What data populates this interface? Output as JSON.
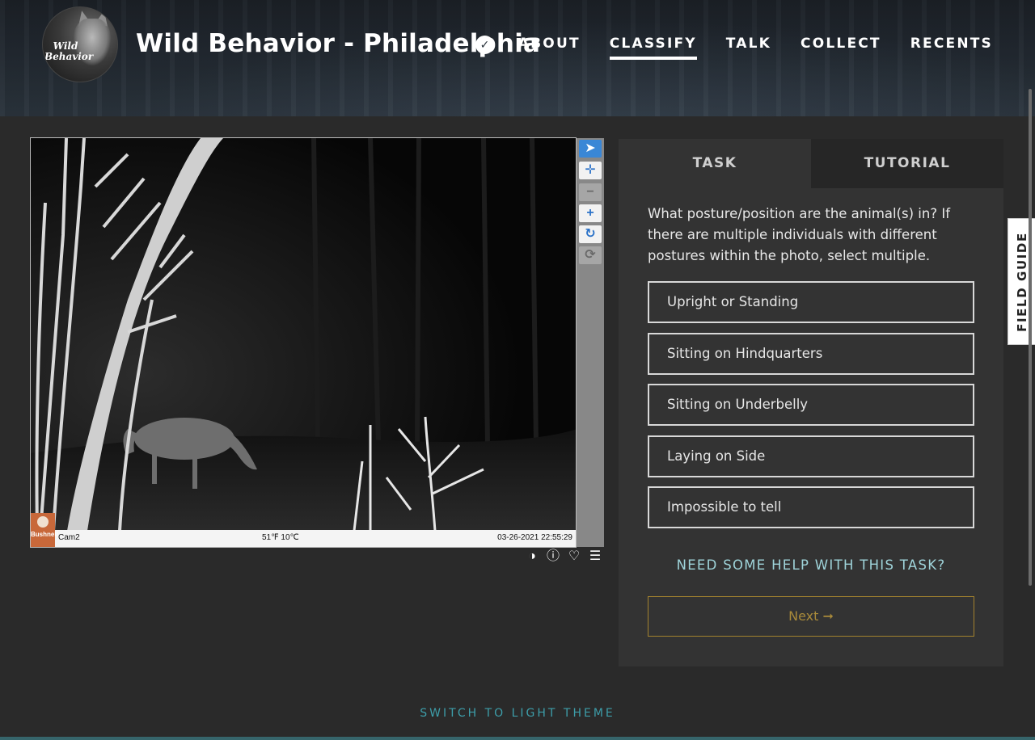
{
  "header": {
    "logo_text": "Wild Behavior",
    "project_title": "Wild Behavior - Philadelphia",
    "verified_icon": "check",
    "nav": [
      {
        "label": "ABOUT",
        "active": false
      },
      {
        "label": "CLASSIFY",
        "active": true
      },
      {
        "label": "TALK",
        "active": false
      },
      {
        "label": "COLLECT",
        "active": false
      },
      {
        "label": "RECENTS",
        "active": false
      }
    ]
  },
  "subject": {
    "camera_brand": "Bushnell",
    "camera_name": "Cam2",
    "temperature": "51℉ 10℃",
    "timestamp": "03-26-2021 22:55:29"
  },
  "viewer_tools": [
    {
      "name": "pointer-icon",
      "glyph": "➤"
    },
    {
      "name": "move-icon",
      "glyph": "✛"
    },
    {
      "name": "zoom-out-icon",
      "glyph": "−"
    },
    {
      "name": "zoom-in-icon",
      "glyph": "+"
    },
    {
      "name": "rotate-icon",
      "glyph": "↻"
    },
    {
      "name": "reset-icon",
      "glyph": "⟳"
    }
  ],
  "meta_icons": {
    "invert": "◑",
    "info": "ⓘ",
    "favorite": "♡",
    "collect": "☰"
  },
  "task_panel": {
    "tabs": {
      "task": "TASK",
      "tutorial": "TUTORIAL"
    },
    "question": "What posture/position are the animal(s) in? If there are multiple individuals with different postures within the photo, select multiple.",
    "answers": [
      "Upright or Standing",
      "Sitting on Hindquarters",
      "Sitting on Underbelly",
      "Laying on Side",
      "Impossible to tell"
    ],
    "help": "NEED SOME HELP WITH THIS TASK?",
    "next": "Next ➞"
  },
  "field_guide": "FIELD GUIDE",
  "footer": {
    "theme_switch": "SWITCH TO LIGHT THEME"
  },
  "colors": {
    "page_bg": "#2a2a2a",
    "panel_bg": "#333333",
    "help_text": "#9fd4da",
    "next_border": "#a3822e",
    "theme_link": "#3d9eaa"
  }
}
